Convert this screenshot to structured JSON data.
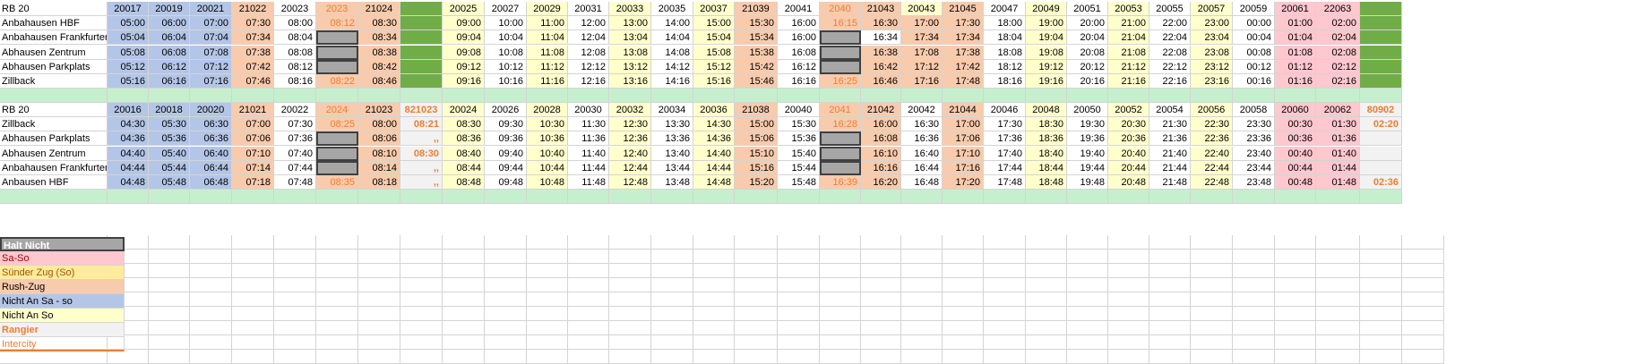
{
  "columns": [
    {
      "c": 0,
      "bg": ""
    },
    {
      "c": 1,
      "bg": "blue"
    },
    {
      "c": 2,
      "bg": "blue"
    },
    {
      "c": 3,
      "bg": "blue"
    },
    {
      "c": 4,
      "bg": "peach"
    },
    {
      "c": 5,
      "bg": ""
    },
    {
      "c": 6,
      "bg": "peach",
      "txt": "orangetxt"
    },
    {
      "c": 7,
      "bg": "peach"
    },
    {
      "c": 8,
      "bg": "green"
    },
    {
      "c": 9,
      "bg": "yellow"
    },
    {
      "c": 10,
      "bg": ""
    },
    {
      "c": 11,
      "bg": "yellow"
    },
    {
      "c": 12,
      "bg": ""
    },
    {
      "c": 13,
      "bg": "yellow"
    },
    {
      "c": 14,
      "bg": ""
    },
    {
      "c": 15,
      "bg": "yellow"
    },
    {
      "c": 16,
      "bg": "peach"
    },
    {
      "c": 17,
      "bg": ""
    },
    {
      "c": 18,
      "bg": "peach",
      "txt": "orangetxt"
    },
    {
      "c": 19,
      "bg": "peach"
    },
    {
      "c": 20,
      "bg": "yellow"
    },
    {
      "c": 21,
      "bg": "peach"
    },
    {
      "c": 22,
      "bg": ""
    },
    {
      "c": 23,
      "bg": "yellow"
    },
    {
      "c": 24,
      "bg": ""
    },
    {
      "c": 25,
      "bg": "yellow"
    },
    {
      "c": 26,
      "bg": ""
    },
    {
      "c": 27,
      "bg": "yellow"
    },
    {
      "c": 28,
      "bg": ""
    },
    {
      "c": 29,
      "bg": "pink"
    },
    {
      "c": 30,
      "bg": "pink"
    },
    {
      "c": 31,
      "bg": "green"
    }
  ],
  "block1": {
    "rows": [
      [
        "RB 20",
        "20017",
        "20019",
        "20021",
        "21022",
        "20023",
        "2023",
        "21024",
        "",
        "20025",
        "20027",
        "20029",
        "20031",
        "20033",
        "20035",
        "20037",
        "21039",
        "20041",
        "2040",
        "21043",
        "20043",
        "21045",
        "20047",
        "20049",
        "20051",
        "20053",
        "20055",
        "20057",
        "20059",
        "20061",
        "22063",
        ""
      ],
      [
        "Anbahausen HBF",
        "05:00",
        "06:00",
        "07:00",
        "07:30",
        "08:00",
        "08:12",
        "08:30",
        "",
        "09:00",
        "10:00",
        "11:00",
        "12:00",
        "13:00",
        "14:00",
        "15:00",
        "15:30",
        "16:00",
        "16:15",
        "16:30",
        "17:00",
        "17:30",
        "18:00",
        "19:00",
        "20:00",
        "21:00",
        "22:00",
        "23:00",
        "00:00",
        "01:00",
        "02:00",
        ""
      ],
      [
        "Anbahausen Frankfurter",
        "05:04",
        "06:04",
        "07:04",
        "07:34",
        "08:04",
        "#",
        "08:34",
        "",
        "09:04",
        "10:04",
        "11:04",
        "12:04",
        "13:04",
        "14:04",
        "15:04",
        "15:34",
        "16:00",
        "#",
        "16:34",
        "17:34",
        "17:34",
        "18:04",
        "19:04",
        "20:04",
        "21:04",
        "22:04",
        "23:04",
        "00:04",
        "01:04",
        "02:04",
        ""
      ],
      [
        "Abhausen Zentrum",
        "05:08",
        "06:08",
        "07:08",
        "07:38",
        "08:08",
        "#",
        "08:38",
        "",
        "09:08",
        "10:08",
        "11:08",
        "12:08",
        "13:08",
        "14:08",
        "15:08",
        "15:38",
        "16:08",
        "#",
        "16:38",
        "17:08",
        "17:38",
        "18:08",
        "19:08",
        "20:08",
        "21:08",
        "22:08",
        "23:08",
        "00:08",
        "01:08",
        "02:08",
        ""
      ],
      [
        "Abhausen Parkplats",
        "05:12",
        "06:12",
        "07:12",
        "07:42",
        "08:12",
        "#",
        "08:42",
        "",
        "09:12",
        "10:12",
        "11:12",
        "12:12",
        "13:12",
        "14:12",
        "15:12",
        "15:42",
        "16:12",
        "#",
        "16:42",
        "17:12",
        "17:42",
        "18:12",
        "19:12",
        "20:12",
        "21:12",
        "22:12",
        "23:12",
        "00:12",
        "01:12",
        "02:12",
        ""
      ],
      [
        "Zillback",
        "05:16",
        "06:16",
        "07:16",
        "07:46",
        "08:16",
        "08:22",
        "08:46",
        "",
        "09:16",
        "10:16",
        "11:16",
        "12:16",
        "13:16",
        "14:16",
        "15:16",
        "15:46",
        "16:16",
        "16:25",
        "16:46",
        "17:16",
        "17:48",
        "18:16",
        "19:16",
        "20:16",
        "21:16",
        "22:16",
        "23:16",
        "00:16",
        "01:16",
        "02:16",
        ""
      ]
    ]
  },
  "block2": {
    "rows": [
      [
        "RB 20",
        "20016",
        "20018",
        "20020",
        "21021",
        "20022",
        "2024",
        "21023",
        "821023",
        "20024",
        "20026",
        "20028",
        "20030",
        "20032",
        "20034",
        "20036",
        "21038",
        "20040",
        "2041",
        "21042",
        "20042",
        "21044",
        "20046",
        "20048",
        "20050",
        "20052",
        "20054",
        "20056",
        "20058",
        "20060",
        "20062",
        "80902"
      ],
      [
        "Zillback",
        "04:30",
        "05:30",
        "06:30",
        "07:00",
        "07:30",
        "08:25",
        "08:00",
        "08:21",
        "08:30",
        "09:30",
        "10:30",
        "11:30",
        "12:30",
        "13:30",
        "14:30",
        "15:00",
        "15:30",
        "16:28",
        "16:00",
        "16:30",
        "17:00",
        "17:30",
        "18:30",
        "19:30",
        "20:30",
        "21:30",
        "22:30",
        "23:30",
        "00:30",
        "01:30",
        "02:20"
      ],
      [
        "Abhausen Parkplats",
        "04:36",
        "05:36",
        "06:36",
        "07:06",
        "07:36",
        "#",
        "08:06",
        ",,",
        "08:36",
        "09:36",
        "10:36",
        "11:36",
        "12:36",
        "13:36",
        "14:36",
        "15:06",
        "15:36",
        "#",
        "16:08",
        "16:36",
        "17:06",
        "17:36",
        "18:36",
        "19:36",
        "20:36",
        "21:36",
        "22:36",
        "23:36",
        "00:36",
        "01:36",
        ""
      ],
      [
        "Abhausen Zentrum",
        "04:40",
        "05:40",
        "06:40",
        "07:10",
        "07:40",
        "#",
        "08:10",
        "08:30",
        "08:40",
        "09:40",
        "10:40",
        "11:40",
        "12:40",
        "13:40",
        "14:40",
        "15:10",
        "15:40",
        "#",
        "16:10",
        "16:40",
        "17:10",
        "17:40",
        "18:40",
        "19:40",
        "20:40",
        "21:40",
        "22:40",
        "23:40",
        "00:40",
        "01:40",
        ""
      ],
      [
        "Anbahausen Frankfurter",
        "04:44",
        "05:44",
        "06:44",
        "07:14",
        "07:44",
        "#",
        "08:14",
        ",,",
        "08:44",
        "09:44",
        "10:44",
        "11:44",
        "12:44",
        "13:44",
        "14:44",
        "15:16",
        "15:44",
        "#",
        "16:16",
        "16:44",
        "17:16",
        "17:44",
        "18:44",
        "19:44",
        "20:44",
        "21:44",
        "22:44",
        "23:44",
        "00:44",
        "01:44",
        ""
      ],
      [
        "Anbausen HBF",
        "04:48",
        "05:48",
        "06:48",
        "07:18",
        "07:48",
        "08:35",
        "08:18",
        ",,",
        "08:48",
        "09:48",
        "10:48",
        "11:48",
        "12:48",
        "13:48",
        "14:48",
        "15:20",
        "15:48",
        "16:39",
        "16:20",
        "16:48",
        "17:20",
        "17:48",
        "18:48",
        "19:48",
        "20:48",
        "21:48",
        "22:48",
        "23:48",
        "00:48",
        "01:48",
        "02:36"
      ]
    ]
  },
  "legend": {
    "items": [
      {
        "label": "Halt Nicht",
        "style": "halt"
      },
      {
        "label": "Sa-So",
        "style": "pink"
      },
      {
        "label": "Sünder Zug (So)",
        "style": "yellowstrong"
      },
      {
        "label": "Rush-Zug",
        "style": "peach"
      },
      {
        "label": "Nicht An Sa - so",
        "style": "blue"
      },
      {
        "label": "Nicht An So",
        "style": "yellow"
      },
      {
        "label": "Rangier",
        "style": "rangier"
      },
      {
        "label": "Intercity",
        "style": "intercity"
      }
    ]
  },
  "colors": {
    "blue": "#b4c6e7",
    "yellow": "#ffffcc",
    "peach": "#f8cbad",
    "pink": "#ffc7ce",
    "green": "#70ad47",
    "halt": "#a6a6a6",
    "separator": "#c6efce",
    "orange": "#ed7d31"
  }
}
